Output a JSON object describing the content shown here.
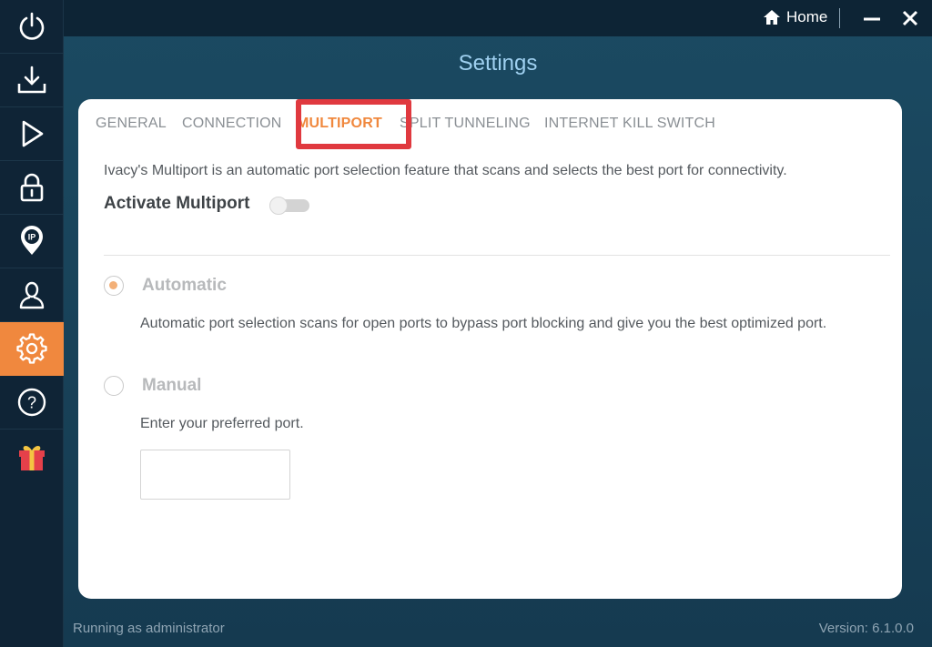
{
  "window": {
    "home_label": "Home",
    "title": "Settings"
  },
  "sidebar": {
    "items": [
      {
        "name": "power",
        "icon": "power-icon"
      },
      {
        "name": "download",
        "icon": "download-icon"
      },
      {
        "name": "play",
        "icon": "play-icon"
      },
      {
        "name": "lock",
        "icon": "lock-icon"
      },
      {
        "name": "ip",
        "icon": "ip-location-icon",
        "label": "IP"
      },
      {
        "name": "account",
        "icon": "user-icon"
      },
      {
        "name": "settings",
        "icon": "gear-icon",
        "active": true
      },
      {
        "name": "help",
        "icon": "help-icon",
        "label": "?"
      },
      {
        "name": "gift",
        "icon": "gift-icon"
      }
    ]
  },
  "tabs": [
    {
      "label": "GENERAL"
    },
    {
      "label": "CONNECTION"
    },
    {
      "label": "MULTIPORT",
      "active": true
    },
    {
      "label": "SPLIT TUNNELING"
    },
    {
      "label": "INTERNET KILL SWITCH"
    }
  ],
  "multiport": {
    "description": "Ivacy's Multiport  is an automatic port selection feature that scans and selects the best port for connectivity.",
    "activate_label": "Activate Multiport",
    "activate_on": false,
    "options": {
      "automatic": {
        "label": "Automatic",
        "selected": true,
        "description": "Automatic port selection scans for open ports to bypass port blocking and give you the best optimized port."
      },
      "manual": {
        "label": "Manual",
        "selected": false,
        "description": "Enter your preferred port.",
        "port_value": ""
      }
    }
  },
  "status": {
    "left": "Running as administrator",
    "right": "Version:  6.1.0.0"
  },
  "colors": {
    "accent": "#f0883e",
    "highlight": "#e0393f",
    "title": "#9fd0f0"
  }
}
